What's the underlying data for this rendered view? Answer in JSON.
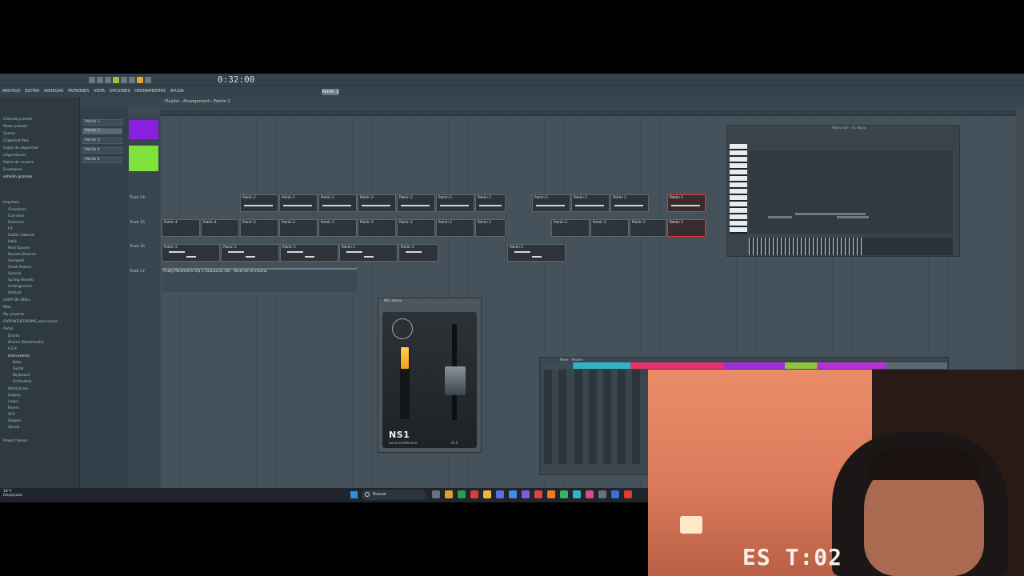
{
  "menu": {
    "items": [
      "ARCHIVO",
      "EDITAR",
      "AGREGAR",
      "PATRONES",
      "VISTA",
      "OPCIONES",
      "HERRAMIENTAS",
      "AYUDA"
    ]
  },
  "transport": {
    "time": "0:32:00",
    "pattern": "Patrón 2"
  },
  "playlist": {
    "title": "Playlist - Arrangement › Patrón 2"
  },
  "browser": {
    "items": [
      "Channel presets",
      "Mixer presets",
      "Scores",
      "Clipboard files",
      "Copia de seguridad",
      "cityproducer",
      "Datos de usuario",
      "Envelopes",
      "estarlin guzman",
      "Impulses",
      "Chambers",
      "Corridors",
      "Exteriors",
      "FX",
      "Guitar Cabinet",
      "Halls",
      "Real Spaces",
      "Reverb Devices",
      "Sampled",
      "Small Rooms",
      "Special",
      "Spring Reverb",
      "Underground",
      "Default",
      "LOOP DE DRILL",
      "Misc",
      "My projects",
      "OVPONTHEDRUMS_percussion",
      "Packs",
      "Drums",
      "Drums (ModeAudio)",
      "FLEX",
      "Instruments",
      "Bass",
      "Guitar",
      "Keyboard",
      "Orchestral",
      "Kits/Library",
      "Legacy",
      "Loops",
      "Risers",
      "SFX",
      "Shapes",
      "Vocals",
      "Project bones"
    ]
  },
  "patterns": [
    "Patrón 1",
    "Patrón 2",
    "Patrón 3",
    "Patrón 4",
    "Patrón 5"
  ],
  "tracks": [
    "Track 14",
    "Track 15",
    "Track 16",
    "Track 17"
  ],
  "clips": {
    "pattern2_label": "Patrón 2",
    "pattern3_label": "Patrón 3",
    "pattern4_label": "Patrón 4",
    "pattern5_label": "Patrón 5",
    "automation_label": "Fruity Parametric EQ 2 (Ganancia 28) - Nivel de la mezcla"
  },
  "piano_roll": {
    "title": "Piano roll - FL Keys"
  },
  "plugin": {
    "title": "NS1 Stereo",
    "logo": "NS1",
    "subtitle": "NOISE SUPPRESSOR",
    "value": "-45.0",
    "meter_level": 0.3,
    "accent": "#f0a030"
  },
  "mixer": {
    "title": "Mixer - Master"
  },
  "taskbar": {
    "search_placeholder": "Buscar",
    "weather_temp": "18°C",
    "weather_desc": "Despejado"
  },
  "webcam": {
    "clock": "ES T:02"
  }
}
